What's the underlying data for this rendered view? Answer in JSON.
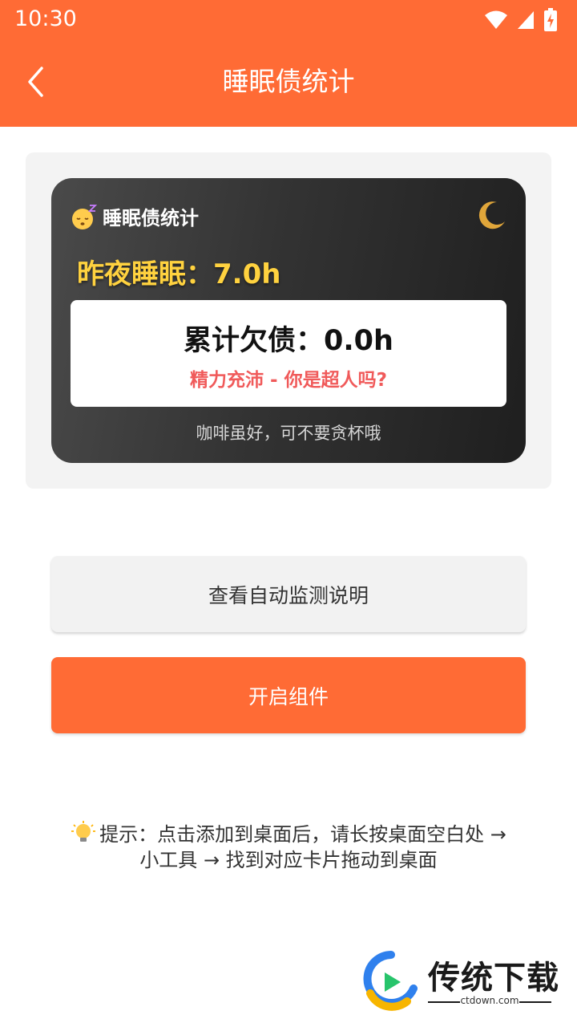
{
  "status_bar": {
    "time": "10:30"
  },
  "app_bar": {
    "title": "睡眠债统计"
  },
  "widget": {
    "title": "睡眠债统计",
    "last_night": "昨夜睡眠：7.0h",
    "debt_total": "累计欠债：0.0h",
    "debt_status": "精力充沛 - 你是超人吗?",
    "tip": "咖啡虽好，可不要贪杯哦"
  },
  "buttons": {
    "help_label": "查看自动监测说明",
    "enable_label": "开启组件"
  },
  "hint": {
    "line1": "提示：点击添加到桌面后，请长按桌面空白处 →",
    "line2": "小工具 → 找到对应卡片拖动到桌面"
  },
  "watermark": {
    "brand": "传统下载",
    "url": "ctdown.com"
  },
  "colors": {
    "accent": "#ff6b35",
    "highlight_yellow": "#ffd23f",
    "status_red": "#f05a5a"
  }
}
